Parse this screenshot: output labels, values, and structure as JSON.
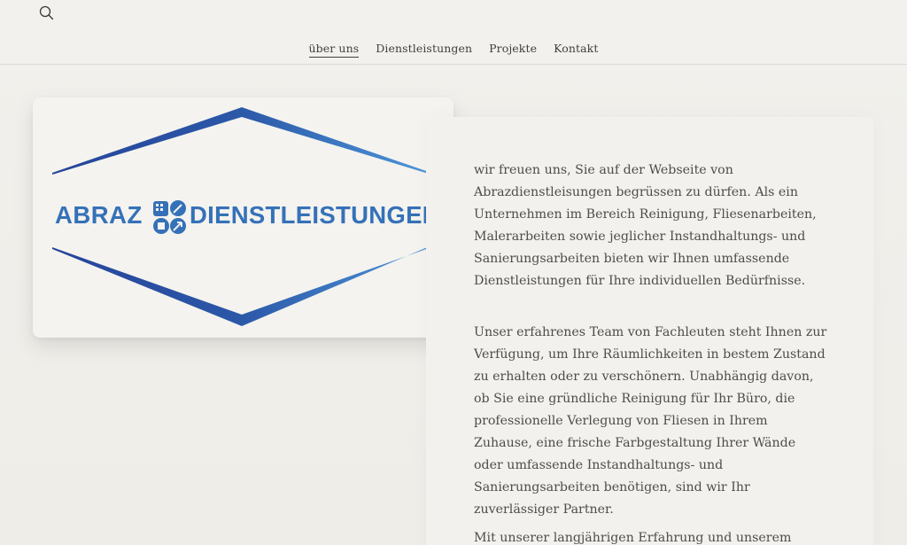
{
  "header": {
    "search_icon": "search-icon",
    "nav": [
      {
        "label": "über uns",
        "active": true
      },
      {
        "label": "Dienstleistungen",
        "active": false
      },
      {
        "label": "Projekte",
        "active": false
      },
      {
        "label": "Kontakt",
        "active": false
      }
    ]
  },
  "logo": {
    "left_text": "ABRAZ",
    "right_text": "DIENSTLEISTUNGEN",
    "emblem_icon": "tools-emblem-icon",
    "colors": {
      "primary": "#3571b8",
      "dark": "#2a4f98",
      "light": "#4d96d9"
    }
  },
  "content": {
    "paragraph1": "wir freuen uns, Sie auf der Webseite von Abrazdienstleisungen begrüssen zu dürfen. Als ein Unternehmen im Bereich Reinigung, Fliesenarbeiten, Malerarbeiten sowie jeglicher Instandhaltungs- und Sanierungsarbeiten bieten wir Ihnen umfassende Dienstleistungen für Ihre individuellen Bedürfnisse.",
    "paragraph2": "Unser erfahrenes Team von Fachleuten steht Ihnen zur Verfügung, um Ihre Räumlichkeiten in bestem Zustand zu erhalten oder zu verschönern. Unabhängig davon, ob Sie eine gründliche Reinigung für Ihr Büro, die professionelle Verlegung von Fliesen in Ihrem Zuhause, eine frische Farbgestaltung Ihrer Wände oder umfassende Instandhaltungs- und Sanierungsarbeiten benötigen, sind wir Ihr zuverlässiger Partner.",
    "paragraph3": "Mit unserer langjährigen Erfahrung und unserem Engagement für Qualität setzen wir auf erstklassige"
  }
}
